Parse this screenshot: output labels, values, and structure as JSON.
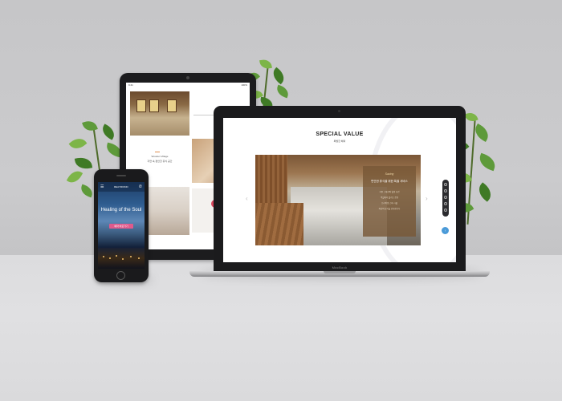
{
  "laptop": {
    "brand": "MacBook",
    "page_title": "SPECIAL VALUE",
    "page_subtitle": "특별한 혜택",
    "card": {
      "label": "Saving",
      "title": "편안한 휴식을 위한 특별 서비스",
      "lines": [
        "자연 그대로의 힐링 공간",
        "객실에서 즐기는 온천",
        "프라이빗 스파 시설",
        "최상의 휴식을 선사합니다"
      ]
    },
    "prev_arrow": "‹",
    "next_arrow": "›",
    "scroll_top": "↑"
  },
  "tablet": {
    "time": "9:41",
    "battery": "100%",
    "section_label": "Wooden Village",
    "section_desc": "자연 속 편안한 휴식 공간"
  },
  "phone": {
    "logo": "REAYRIOND",
    "menu_icon": "☰",
    "call_icon": "✆",
    "headline": "Healing of the Soul",
    "button": "예약 바로가기"
  },
  "colors": {
    "accent_pink": "#e05a8c",
    "card_brown": "#78583a",
    "scroll_blue": "#4a9ad8"
  }
}
